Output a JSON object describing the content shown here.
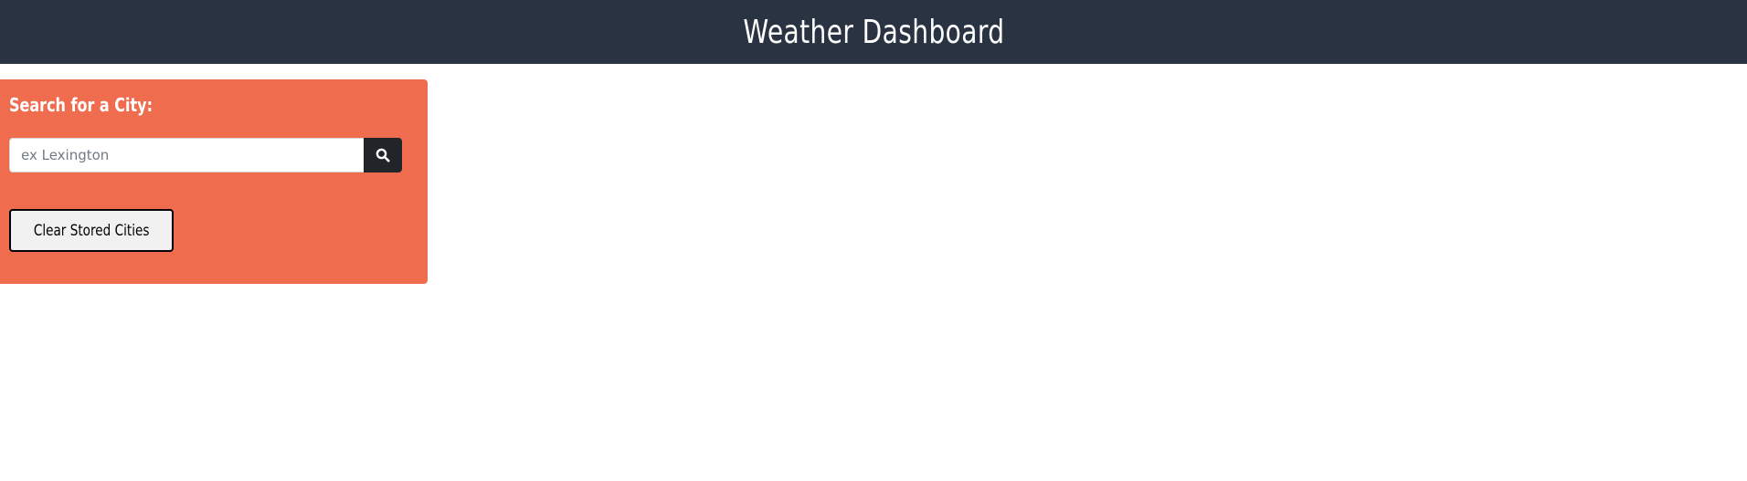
{
  "header": {
    "title": "Weather Dashboard"
  },
  "search": {
    "heading": "Search for a City:",
    "input_value": "",
    "placeholder": "ex Lexington",
    "button_icon": "search-icon"
  },
  "actions": {
    "clear_label": "Clear Stored Cities"
  },
  "colors": {
    "header_bg": "#2a3342",
    "panel_bg": "#ef6c4f",
    "search_button_bg": "#212529"
  }
}
